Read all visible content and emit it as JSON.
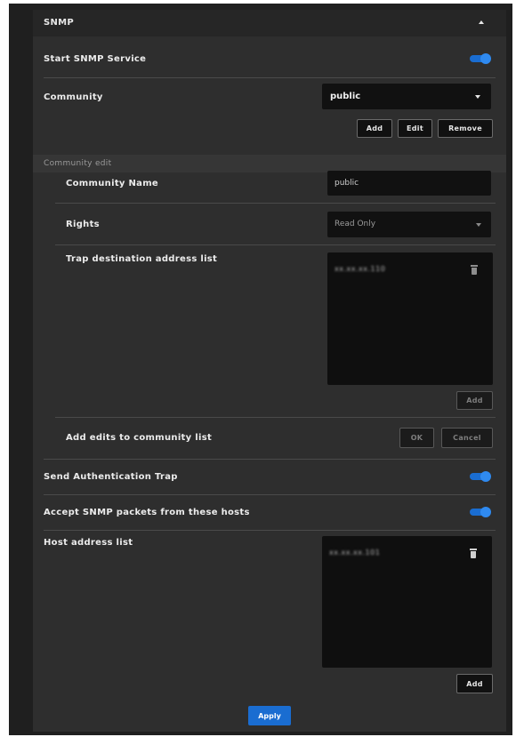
{
  "section": {
    "title": "SNMP"
  },
  "start_snmp": {
    "label": "Start SNMP Service",
    "enabled": true
  },
  "community": {
    "label": "Community",
    "selected": "public",
    "buttons": {
      "add": "Add",
      "edit": "Edit",
      "remove": "Remove"
    }
  },
  "community_edit": {
    "title": "Community edit",
    "name_label": "Community Name",
    "name_value": "public",
    "rights_label": "Rights",
    "rights_value": "Read Only",
    "trap_label": "Trap destination address list",
    "trap_addresses": [
      "xx.xx.xx.110"
    ],
    "trap_add": "Add",
    "add_edits_label": "Add edits to community list",
    "ok": "OK",
    "cancel": "Cancel"
  },
  "auth_trap": {
    "label": "Send Authentication Trap",
    "enabled": true
  },
  "accept_packets": {
    "label": "Accept SNMP packets from these hosts",
    "enabled": true
  },
  "host_list": {
    "label": "Host address list",
    "addresses": [
      "xx.xx.xx.101"
    ],
    "add": "Add"
  },
  "apply": "Apply",
  "colors": {
    "accent": "#1a6dd1",
    "panel": "#2e2e2e",
    "field": "#111111"
  }
}
